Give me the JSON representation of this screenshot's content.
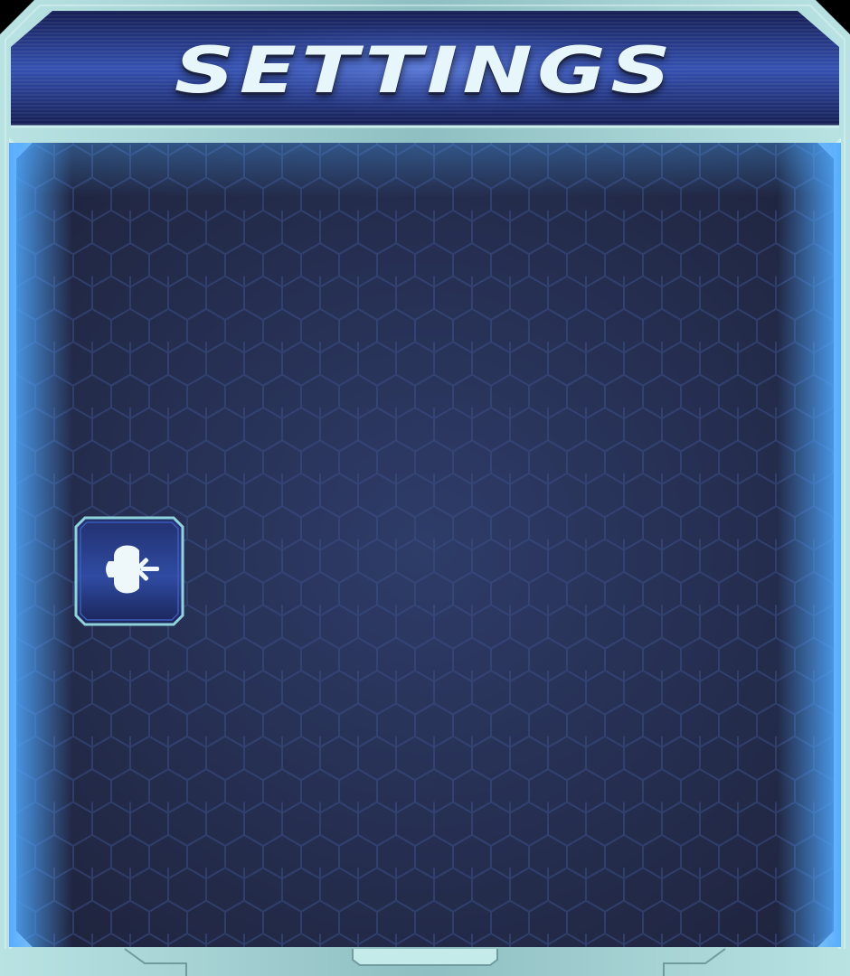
{
  "window": {
    "title": "SETTINGS"
  },
  "buttons": [
    {
      "icon": "speaker-icon"
    }
  ],
  "colors": {
    "frame": "#9cc5c5",
    "header_bg": "#1e2b6e",
    "panel_bg": "#29365e",
    "glow": "#4fa8ff",
    "title_text": "#e6f6fb",
    "button_border": "#8fd4dc"
  }
}
